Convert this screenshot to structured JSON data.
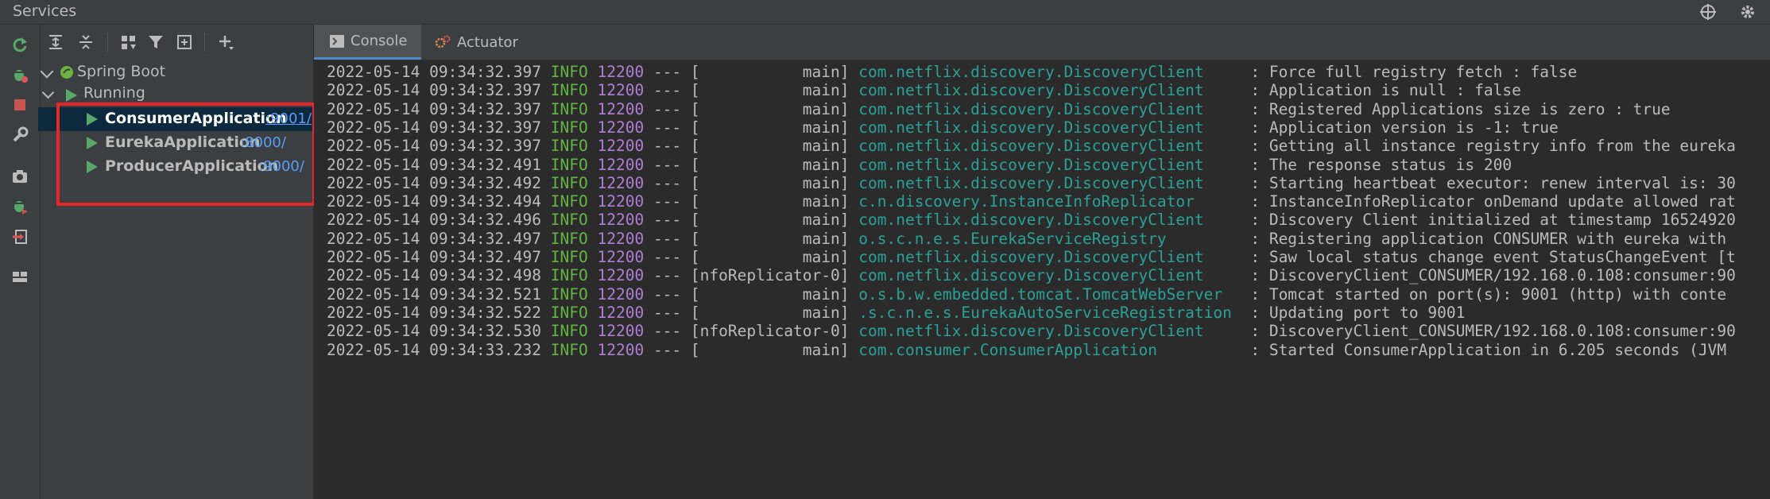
{
  "window": {
    "title": "Services"
  },
  "tree": {
    "root_label": "Spring Boot",
    "group_label": "Running",
    "apps": [
      {
        "name": "ConsumerApplication",
        "port": ":9001/"
      },
      {
        "name": "EurekaApplication",
        "port": ":8000/"
      },
      {
        "name": "ProducerApplication",
        "port": ":9000/"
      }
    ]
  },
  "tabs": [
    {
      "label": "Console"
    },
    {
      "label": "Actuator"
    }
  ],
  "colors": {
    "info": "#62b543",
    "pid": "#b07dd6",
    "logger": "#2aa198",
    "selection_box": "#e8262a",
    "run_icon": "#59a869"
  },
  "console": {
    "lines": [
      {
        "ts": "2022-05-14 09:34:32.397",
        "level": "INFO",
        "pid": "12200",
        "sep": " --- ",
        "thread": "[           main]",
        "logger": "com.netflix.discovery.DiscoveryClient    ",
        "msg": ": Force full registry fetch : false"
      },
      {
        "ts": "2022-05-14 09:34:32.397",
        "level": "INFO",
        "pid": "12200",
        "sep": " --- ",
        "thread": "[           main]",
        "logger": "com.netflix.discovery.DiscoveryClient    ",
        "msg": ": Application is null : false"
      },
      {
        "ts": "2022-05-14 09:34:32.397",
        "level": "INFO",
        "pid": "12200",
        "sep": " --- ",
        "thread": "[           main]",
        "logger": "com.netflix.discovery.DiscoveryClient    ",
        "msg": ": Registered Applications size is zero : true"
      },
      {
        "ts": "2022-05-14 09:34:32.397",
        "level": "INFO",
        "pid": "12200",
        "sep": " --- ",
        "thread": "[           main]",
        "logger": "com.netflix.discovery.DiscoveryClient    ",
        "msg": ": Application version is -1: true"
      },
      {
        "ts": "2022-05-14 09:34:32.397",
        "level": "INFO",
        "pid": "12200",
        "sep": " --- ",
        "thread": "[           main]",
        "logger": "com.netflix.discovery.DiscoveryClient    ",
        "msg": ": Getting all instance registry info from the eureka"
      },
      {
        "ts": "2022-05-14 09:34:32.491",
        "level": "INFO",
        "pid": "12200",
        "sep": " --- ",
        "thread": "[           main]",
        "logger": "com.netflix.discovery.DiscoveryClient    ",
        "msg": ": The response status is 200"
      },
      {
        "ts": "2022-05-14 09:34:32.492",
        "level": "INFO",
        "pid": "12200",
        "sep": " --- ",
        "thread": "[           main]",
        "logger": "com.netflix.discovery.DiscoveryClient    ",
        "msg": ": Starting heartbeat executor: renew interval is: 30"
      },
      {
        "ts": "2022-05-14 09:34:32.494",
        "level": "INFO",
        "pid": "12200",
        "sep": " --- ",
        "thread": "[           main]",
        "logger": "c.n.discovery.InstanceInfoReplicator     ",
        "msg": ": InstanceInfoReplicator onDemand update allowed rat"
      },
      {
        "ts": "2022-05-14 09:34:32.496",
        "level": "INFO",
        "pid": "12200",
        "sep": " --- ",
        "thread": "[           main]",
        "logger": "com.netflix.discovery.DiscoveryClient    ",
        "msg": ": Discovery Client initialized at timestamp 16524920"
      },
      {
        "ts": "2022-05-14 09:34:32.497",
        "level": "INFO",
        "pid": "12200",
        "sep": " --- ",
        "thread": "[           main]",
        "logger": "o.s.c.n.e.s.EurekaServiceRegistry        ",
        "msg": ": Registering application CONSUMER with eureka with "
      },
      {
        "ts": "2022-05-14 09:34:32.497",
        "level": "INFO",
        "pid": "12200",
        "sep": " --- ",
        "thread": "[           main]",
        "logger": "com.netflix.discovery.DiscoveryClient    ",
        "msg": ": Saw local status change event StatusChangeEvent [t"
      },
      {
        "ts": "2022-05-14 09:34:32.498",
        "level": "INFO",
        "pid": "12200",
        "sep": " --- ",
        "thread": "[nfoReplicator-0]",
        "logger": "com.netflix.discovery.DiscoveryClient    ",
        "msg": ": DiscoveryClient_CONSUMER/192.168.0.108:consumer:90"
      },
      {
        "ts": "2022-05-14 09:34:32.521",
        "level": "INFO",
        "pid": "12200",
        "sep": " --- ",
        "thread": "[           main]",
        "logger": "o.s.b.w.embedded.tomcat.TomcatWebServer  ",
        "msg": ": Tomcat started on port(s): 9001 (http) with conte"
      },
      {
        "ts": "2022-05-14 09:34:32.522",
        "level": "INFO",
        "pid": "12200",
        "sep": " --- ",
        "thread": "[           main]",
        "logger": ".s.c.n.e.s.EurekaAutoServiceRegistration ",
        "msg": ": Updating port to 9001"
      },
      {
        "ts": "2022-05-14 09:34:32.530",
        "level": "INFO",
        "pid": "12200",
        "sep": " --- ",
        "thread": "[nfoReplicator-0]",
        "logger": "com.netflix.discovery.DiscoveryClient    ",
        "msg": ": DiscoveryClient_CONSUMER/192.168.0.108:consumer:90"
      },
      {
        "ts": "2022-05-14 09:34:33.232",
        "level": "INFO",
        "pid": "12200",
        "sep": " --- ",
        "thread": "[           main]",
        "logger": "com.consumer.ConsumerApplication         ",
        "msg": ": Started ConsumerApplication in 6.205 seconds (JVM"
      }
    ]
  }
}
